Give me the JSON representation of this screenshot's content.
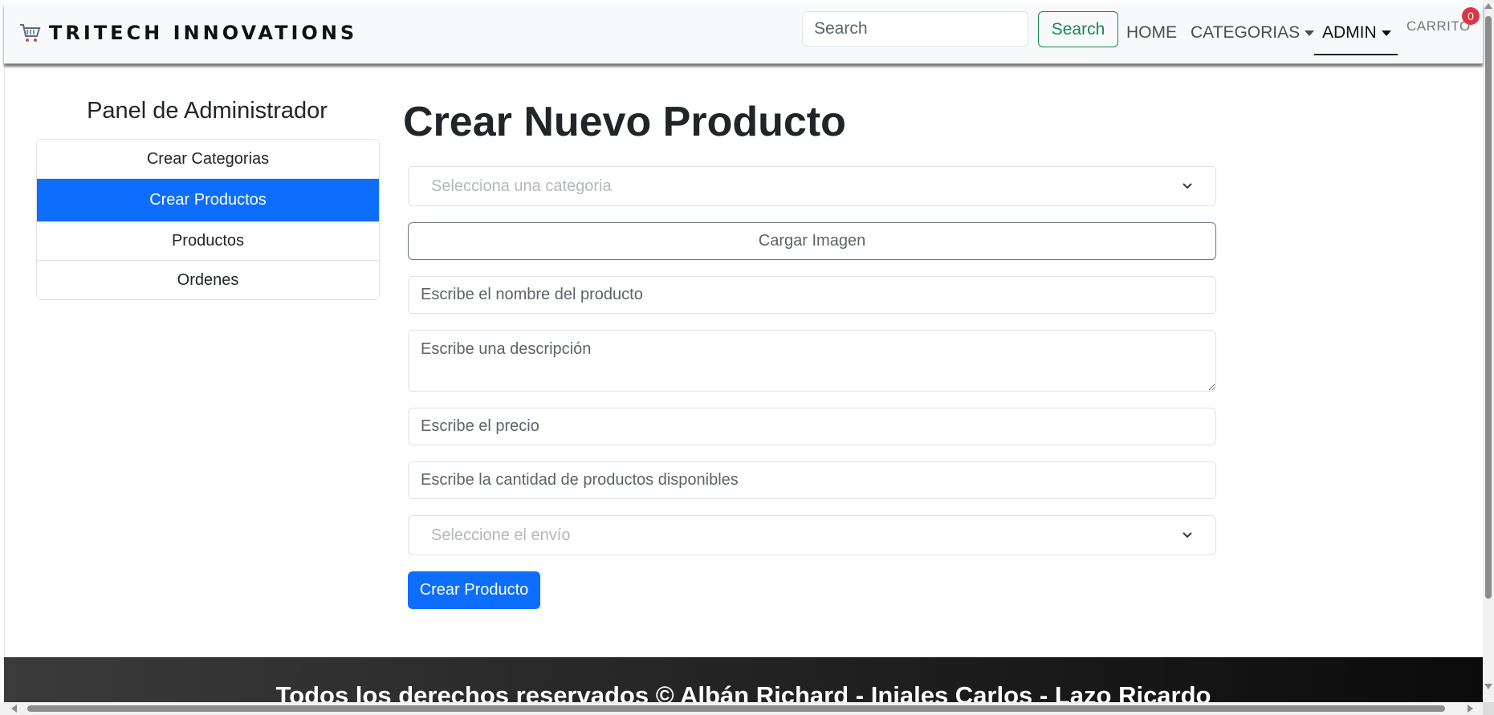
{
  "navbar": {
    "brand": "TRITECH INNOVATIONS",
    "brand_icon": "shopping-cart-icon",
    "search_placeholder": "Search",
    "search_button": "Search",
    "links": {
      "home": "HOME",
      "categories": "CATEGORIAS",
      "admin": "ADMIN",
      "cart": "CARRITO"
    },
    "cart_count": "0"
  },
  "sidebar": {
    "title": "Panel de Administrador",
    "items": [
      {
        "label": "Crear Categorias",
        "active": false
      },
      {
        "label": "Crear Productos",
        "active": true
      },
      {
        "label": "Productos",
        "active": false
      },
      {
        "label": "Ordenes",
        "active": false
      }
    ]
  },
  "form": {
    "title": "Crear Nuevo Producto",
    "category_select": {
      "selected": "Selecciona una categoria"
    },
    "upload_button": "Cargar Imagen",
    "name_placeholder": "Escribe el nombre del producto",
    "description_placeholder": "Escribe una descripción",
    "price_placeholder": "Escribe el precio",
    "quantity_placeholder": "Escribe la cantidad de productos disponibles",
    "shipping_select": {
      "selected": "Seleccione el envío"
    },
    "submit_button": "Crear Producto"
  },
  "footer": {
    "text": "Todos los derechos reservados © Albán Richard - Injales Carlos - Lazo Ricardo"
  },
  "colors": {
    "primary": "#0d6efd",
    "success": "#198754",
    "danger": "#dc3545",
    "navbar_bg": "#f8f9fa"
  }
}
